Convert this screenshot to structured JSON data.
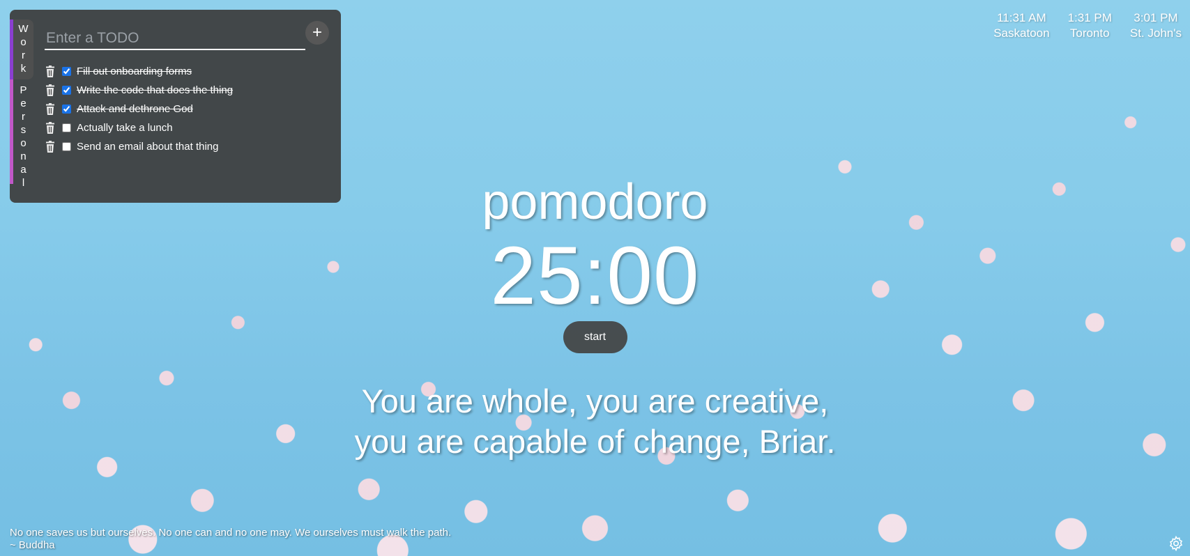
{
  "todo": {
    "lists": [
      {
        "label": "Work",
        "letters": [
          "W",
          "o",
          "r",
          "k"
        ],
        "active": true,
        "color": "#8a3fd0"
      },
      {
        "label": "Personal",
        "letters": [
          "P",
          "e",
          "r",
          "s",
          "o",
          "n",
          "a",
          "l"
        ],
        "active": false,
        "color": "#c058c8"
      }
    ],
    "input_placeholder": "Enter a TODO",
    "add_label": "+",
    "items": [
      {
        "text": "Fill out onboarding forms",
        "done": true
      },
      {
        "text": "Write the code that does the thing",
        "done": true
      },
      {
        "text": "Attack and dethrone God",
        "done": true
      },
      {
        "text": "Actually take a lunch",
        "done": false
      },
      {
        "text": "Send an email about that thing",
        "done": false
      }
    ]
  },
  "clocks": [
    {
      "time": "11:31 AM",
      "city": "Saskatoon"
    },
    {
      "time": "1:31 PM",
      "city": "Toronto"
    },
    {
      "time": "3:01 PM",
      "city": "St. John's"
    }
  ],
  "pomodoro": {
    "title": "pomodoro",
    "time": "25:00",
    "start_label": "start"
  },
  "affirmation": {
    "line1": "You are whole, you are creative,",
    "line2": "you are capable of change, Briar."
  },
  "quote": {
    "text": "No one saves us but ourselves. No one can and no one may. We ourselves must walk the path.",
    "author": "~ Buddha"
  },
  "icons": {
    "trash": "trash-icon",
    "add": "plus-icon",
    "settings": "gear-icon"
  }
}
